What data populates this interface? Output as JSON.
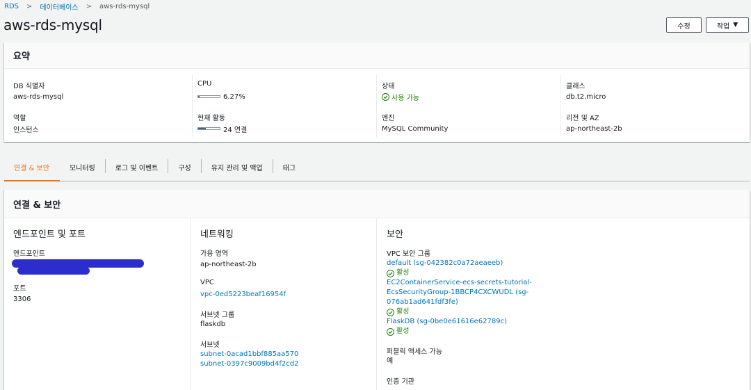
{
  "breadcrumb": {
    "items": [
      "RDS",
      "데이터베이스"
    ],
    "current": "aws-rds-mysql"
  },
  "page": {
    "title": "aws-rds-mysql",
    "modify_label": "수정",
    "actions_label": "작업"
  },
  "summary": {
    "title": "요약",
    "db_id_label": "DB 식별자",
    "db_id_value": "aws-rds-mysql",
    "role_label": "역할",
    "role_value": "인스턴스",
    "cpu_label": "CPU",
    "cpu_value": "6.27%",
    "cpu_fraction": 0.0627,
    "activity_label": "현재 활동",
    "activity_value": "24 연결",
    "activity_fraction": 0.35,
    "status_label": "상태",
    "status_value": "사용 가능",
    "engine_label": "엔진",
    "engine_value": "MySQL Community",
    "class_label": "클래스",
    "class_value": "db.t2.micro",
    "region_label": "리전 및 AZ",
    "region_value": "ap-northeast-2b"
  },
  "tabs": [
    "연결 & 보안",
    "모니터링",
    "로그 및 이벤트",
    "구성",
    "유지 관리 및 백업",
    "태그"
  ],
  "connectivity": {
    "title": "연결 & 보안",
    "endpoint_section": {
      "title": "엔드포인트 및 포트",
      "endpoint_label": "엔드포인트",
      "port_label": "포트",
      "port_value": "3306"
    },
    "network_section": {
      "title": "네트워킹",
      "az_label": "가용 영역",
      "az_value": "ap-northeast-2b",
      "vpc_label": "VPC",
      "vpc_value": "vpc-0ed5223beaf16954f",
      "subnet_group_label": "서브넷 그룹",
      "subnet_group_value": "flaskdb",
      "subnets_label": "서브넷",
      "subnets": [
        "subnet-0acad1bbf885aa570",
        "subnet-0397c9009bd4f2cd2"
      ]
    },
    "security_section": {
      "title": "보안",
      "sg_label": "VPC 보안 그룹",
      "groups": [
        {
          "line1": "default (sg-042382c0a72aeaeeb)",
          "status": "활성"
        },
        {
          "line1": "EC2ContainerService-ecs-secrets-tutorial-",
          "line2": "EcsSecurityGroup-1BBCP4CXCWUDL (sg-",
          "line3": "076ab1ad641fdf3fe)",
          "status": "활성"
        },
        {
          "line1": "FlaskDB (sg-0be0e61616e62789c)",
          "status": "활성"
        }
      ],
      "public_label": "퍼블릭 액세스 가능",
      "public_value": "예",
      "ca_label": "인증 기관"
    }
  },
  "colors": {
    "link": "#0073bb",
    "success": "#1d8102",
    "active_tab": "#ec7211",
    "redaction": "#2b2ecd"
  }
}
